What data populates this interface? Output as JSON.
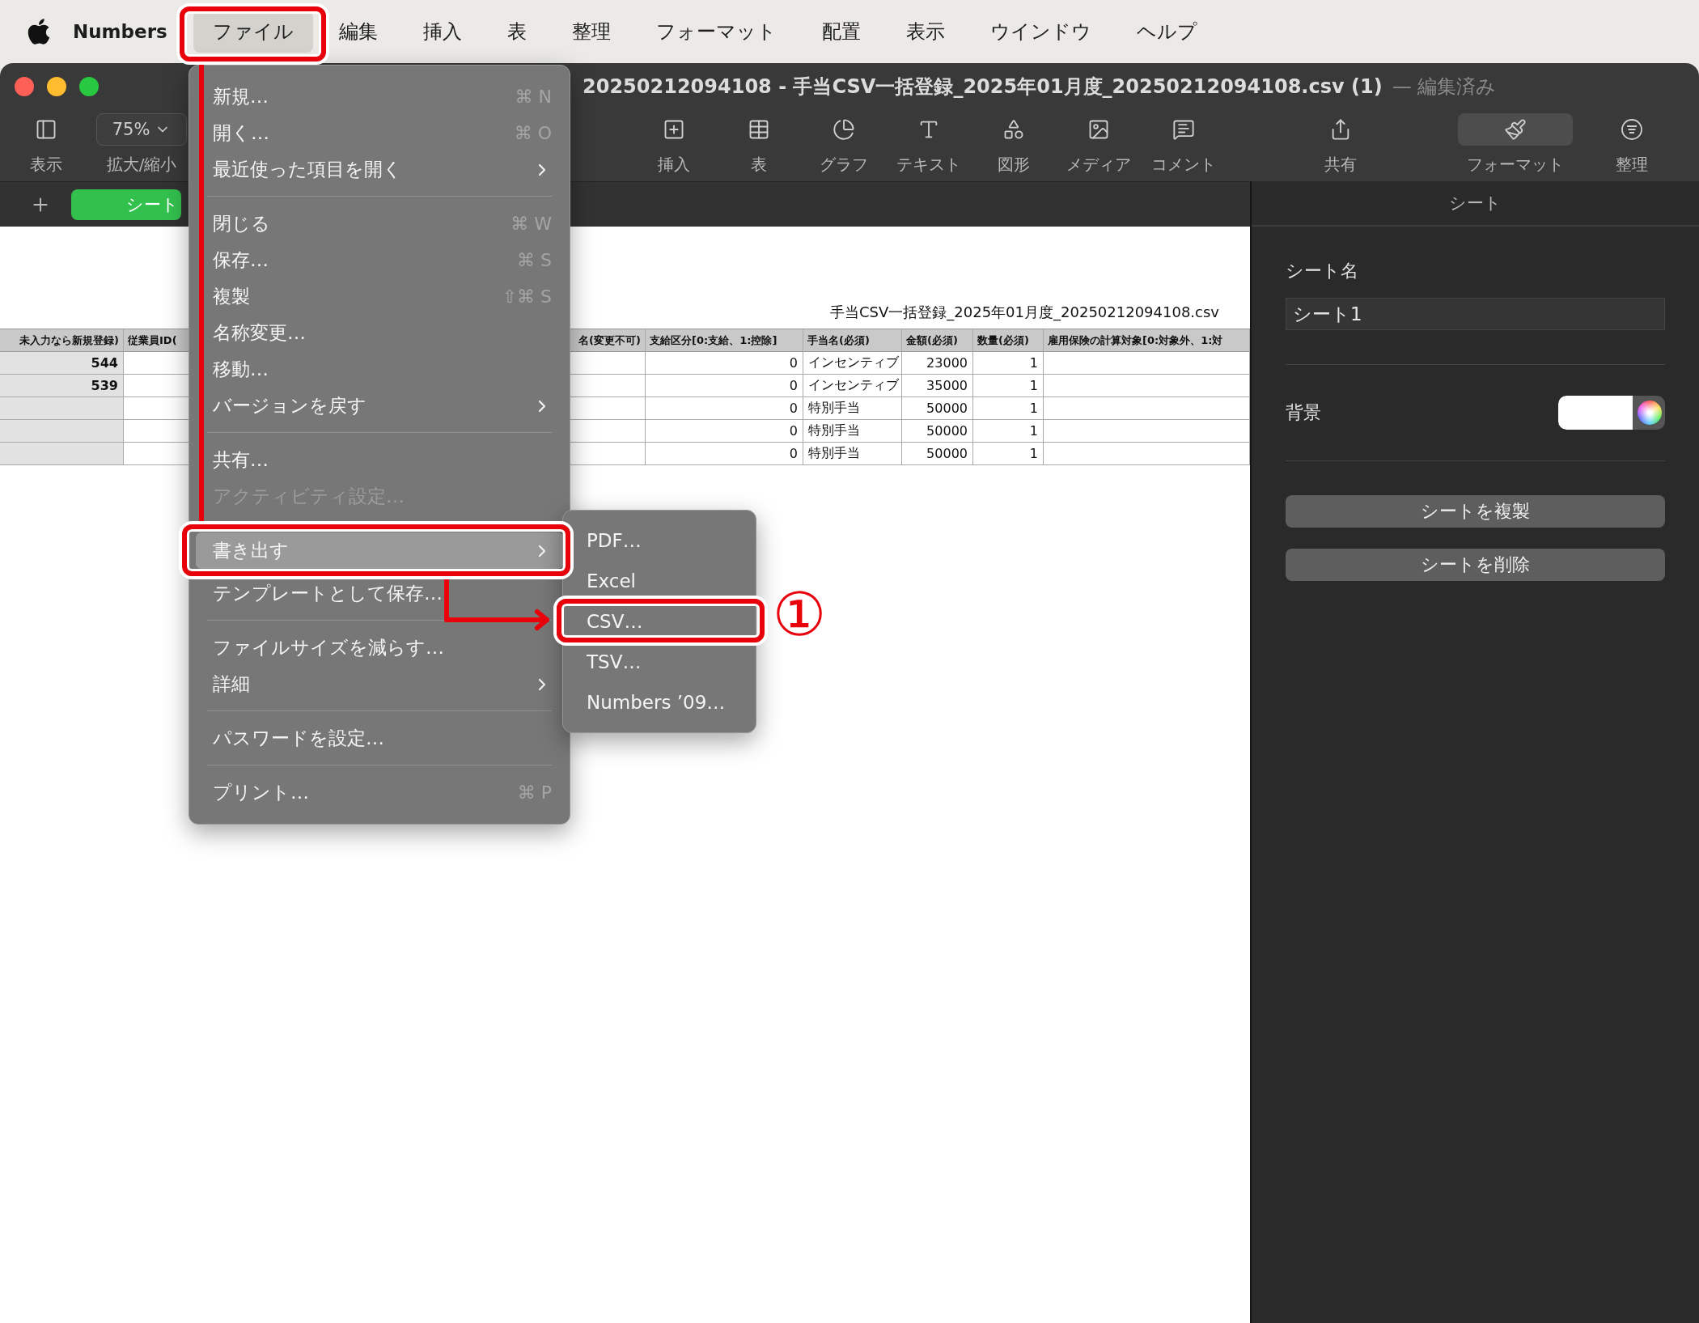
{
  "menubar": {
    "app_name": "Numbers",
    "menus": [
      {
        "label": "ファイル",
        "selected": true
      },
      {
        "label": "編集",
        "selected": false
      },
      {
        "label": "挿入",
        "selected": false
      },
      {
        "label": "表",
        "selected": false
      },
      {
        "label": "整理",
        "selected": false
      },
      {
        "label": "フォーマット",
        "selected": false
      },
      {
        "label": "配置",
        "selected": false
      },
      {
        "label": "表示",
        "selected": false
      },
      {
        "label": "ウインドウ",
        "selected": false
      },
      {
        "label": "ヘルプ",
        "selected": false
      }
    ]
  },
  "window": {
    "title": "20250212094108 - 手当CSV一括登録_2025年01月度_20250212094108.csv (1)",
    "status": "— 編集済み"
  },
  "toolbar": {
    "zoom": "75%",
    "left": [
      {
        "label": "表示",
        "selected": false
      },
      {
        "label": "拡大/縮小",
        "selected": false
      }
    ],
    "center": [
      {
        "label": "挿入",
        "selected": false
      },
      {
        "label": "表",
        "selected": false
      },
      {
        "label": "グラフ",
        "selected": false
      },
      {
        "label": "テキスト",
        "selected": false
      },
      {
        "label": "図形",
        "selected": false
      },
      {
        "label": "メディア",
        "selected": false
      },
      {
        "label": "コメント",
        "selected": false
      }
    ],
    "right": [
      {
        "label": "共有",
        "selected": false
      },
      {
        "label": "フォーマット",
        "selected": true
      },
      {
        "label": "整理",
        "selected": false
      }
    ]
  },
  "sheet_tabs": [
    {
      "label": "シート",
      "selected": true
    }
  ],
  "document": {
    "table_title": "手当CSV一括登録_2025年01月度_20250212094108.csv",
    "table": {
      "columns": [
        "未入力なら新規登録)",
        "従業員ID(",
        "名(変更不可)",
        "支給区分[0:支給、1:控除]",
        "手当名(必須)",
        "金額(必須)",
        "数量(必須)",
        "雇用保険の計算対象[0:対象外、1:対"
      ],
      "rows": [
        {
          "id": "544",
          "pay_class": "0",
          "allowance": "インセンティブ",
          "amount": "23000",
          "quantity": "1"
        },
        {
          "id": "539",
          "pay_class": "0",
          "allowance": "インセンティブ",
          "amount": "35000",
          "quantity": "1"
        },
        {
          "pay_class": "0",
          "allowance": "特別手当",
          "amount": "50000",
          "quantity": "1"
        },
        {
          "pay_class": "0",
          "allowance": "特別手当",
          "amount": "50000",
          "quantity": "1"
        },
        {
          "pay_class": "0",
          "allowance": "特別手当",
          "amount": "50000",
          "quantity": "1"
        }
      ]
    }
  },
  "file_menu": {
    "items": [
      {
        "kind": "item",
        "label": "新規…",
        "shortcut": "⌘ N",
        "selected": false,
        "disabled": false
      },
      {
        "kind": "item",
        "label": "開く…",
        "shortcut": "⌘ O",
        "selected": false,
        "disabled": false
      },
      {
        "kind": "item",
        "label": "最近使った項目を開く",
        "submenu": true,
        "selected": false,
        "disabled": false
      },
      {
        "kind": "separator"
      },
      {
        "kind": "item",
        "label": "閉じる",
        "shortcut": "⌘ W",
        "selected": false,
        "disabled": false
      },
      {
        "kind": "item",
        "label": "保存…",
        "shortcut": "⌘ S",
        "selected": false,
        "disabled": false
      },
      {
        "kind": "item",
        "label": "複製",
        "shortcut": "⇧⌘ S",
        "selected": false,
        "disabled": false
      },
      {
        "kind": "item",
        "label": "名称変更…",
        "selected": false,
        "disabled": false
      },
      {
        "kind": "item",
        "label": "移動…",
        "selected": false,
        "disabled": false
      },
      {
        "kind": "item",
        "label": "バージョンを戻す",
        "submenu": true,
        "selected": false,
        "disabled": false
      },
      {
        "kind": "separator"
      },
      {
        "kind": "item",
        "label": "共有…",
        "selected": false,
        "disabled": false
      },
      {
        "kind": "item",
        "label": "アクティビティ設定…",
        "selected": false,
        "disabled": true
      },
      {
        "kind": "separator"
      },
      {
        "kind": "item",
        "label": "書き出す",
        "submenu": true,
        "selected": true,
        "disabled": false
      },
      {
        "kind": "item",
        "label": "テンプレートとして保存…",
        "selected": false,
        "disabled": false
      },
      {
        "kind": "separator"
      },
      {
        "kind": "item",
        "label": "ファイルサイズを減らす…",
        "selected": false,
        "disabled": false
      },
      {
        "kind": "item",
        "label": "詳細",
        "submenu": true,
        "selected": false,
        "disabled": false
      },
      {
        "kind": "separator"
      },
      {
        "kind": "item",
        "label": "パスワードを設定…",
        "selected": false,
        "disabled": false
      },
      {
        "kind": "separator"
      },
      {
        "kind": "item",
        "label": "プリント…",
        "shortcut": "⌘ P",
        "selected": false,
        "disabled": false
      }
    ]
  },
  "export_submenu": {
    "items": [
      {
        "label": "PDF…",
        "selected": false
      },
      {
        "label": "Excel",
        "selected": false
      },
      {
        "label": "CSV…",
        "selected": false
      },
      {
        "label": "TSV…",
        "selected": false
      },
      {
        "label": "Numbers ’09…",
        "selected": false
      }
    ]
  },
  "inspector": {
    "title": "シート",
    "name_label": "シート名",
    "name_value": "シート1",
    "background_label": "背景",
    "buttons": [
      "シートを複製",
      "シートを削除"
    ]
  },
  "annotation": {
    "step": "①"
  }
}
